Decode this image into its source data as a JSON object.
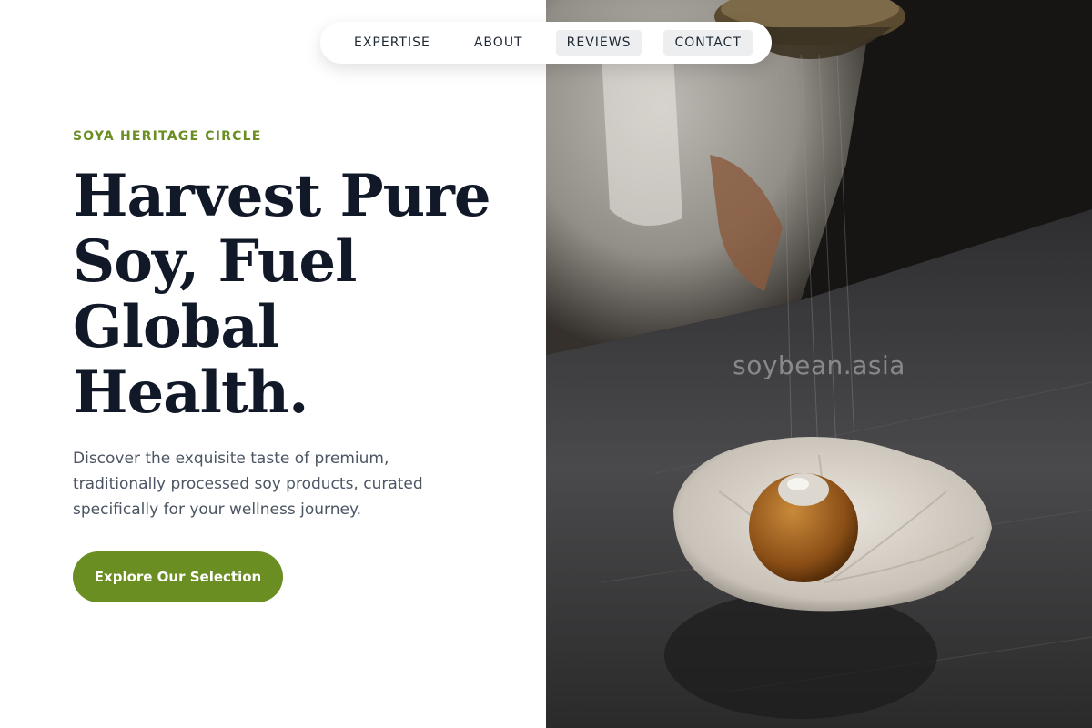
{
  "nav": {
    "items": [
      {
        "label": "EXPERTISE",
        "highlighted": false
      },
      {
        "label": "ABOUT",
        "highlighted": false
      },
      {
        "label": "REVIEWS",
        "highlighted": true
      },
      {
        "label": "CONTACT",
        "highlighted": true
      }
    ]
  },
  "hero": {
    "eyebrow": "SOYA HERITAGE CIRCLE",
    "headline_lines": [
      "Harvest Pure",
      "Soy, Fuel",
      "Global",
      "Health."
    ],
    "description": "Discover the exquisite taste of premium, traditionally processed soy products, curated specifically for your wellness journey.",
    "cta_label": "Explore Our Selection"
  },
  "photo": {
    "watermark": "soybean.asia",
    "subject": "chef dusting powder onto a soy dessert ball in a shell-shaped ceramic dish"
  },
  "colors": {
    "accent": "#6b8e23",
    "headline": "#111827",
    "body_text": "#4b5563",
    "nav_highlight": "#eceeef"
  }
}
